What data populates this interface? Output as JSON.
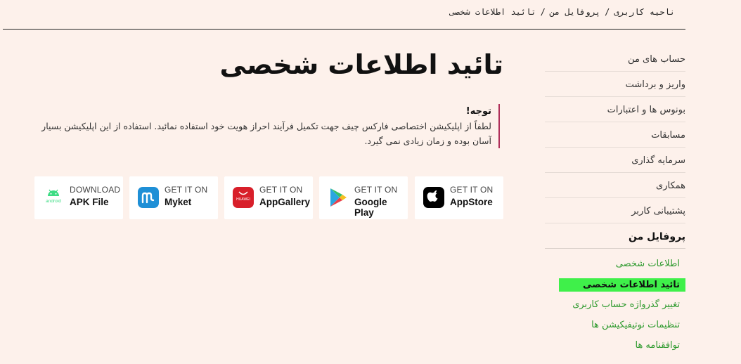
{
  "breadcrumb": {
    "items": [
      "ناحیه کاربری",
      "پروفایل من",
      "تائید اطلاعات شخصی"
    ],
    "separator": "/"
  },
  "page": {
    "title": "تائید اطلاعات شخصی"
  },
  "notice": {
    "title": "توجه!",
    "body": "لطفاً از اپلیکیشن اختصاصی فارکس چیف جهت تکمیل فرآیند احراز هویت خود استفاده نمائید. استفاده از این اپلیکیشن بسیار آسان بوده و زمان زیادی نمی گیرد."
  },
  "stores": [
    {
      "small": "GET IT ON",
      "big": "AppStore",
      "icon": "apple-icon"
    },
    {
      "small": "GET IT ON",
      "big": "Google Play",
      "icon": "google-play-icon"
    },
    {
      "small": "GET IT ON",
      "big": "AppGallery",
      "icon": "huawei-appgallery-icon",
      "icon_text": "HUAWEI"
    },
    {
      "small": "GET IT ON",
      "big": "Myket",
      "icon": "myket-icon"
    },
    {
      "small": "DOWNLOAD",
      "big": "APK File",
      "icon": "android-icon",
      "icon_text": "android"
    }
  ],
  "sidebar": {
    "items": [
      "حساب های من",
      "واریز و برداشت",
      "بونوس ها و اعتبارات",
      "مسابقات",
      "سرمایه گذاری",
      "همکاری",
      "پشتیبانی کاربر",
      "پروفایل من"
    ],
    "submenu": [
      "اطلاعات شخصی",
      "تائید اطلاعات شخصی",
      "تغییر گذرواژه حساب کاربری",
      "تنظیمات نوتیفیکیشن ها",
      "توافقنامه ها"
    ],
    "active_sub_index": 1
  },
  "colors": {
    "background": "#fdf1eb",
    "submenu_link": "#2e9a2e",
    "active_highlight": "#3ff04a",
    "notice_border": "#b0305a"
  }
}
